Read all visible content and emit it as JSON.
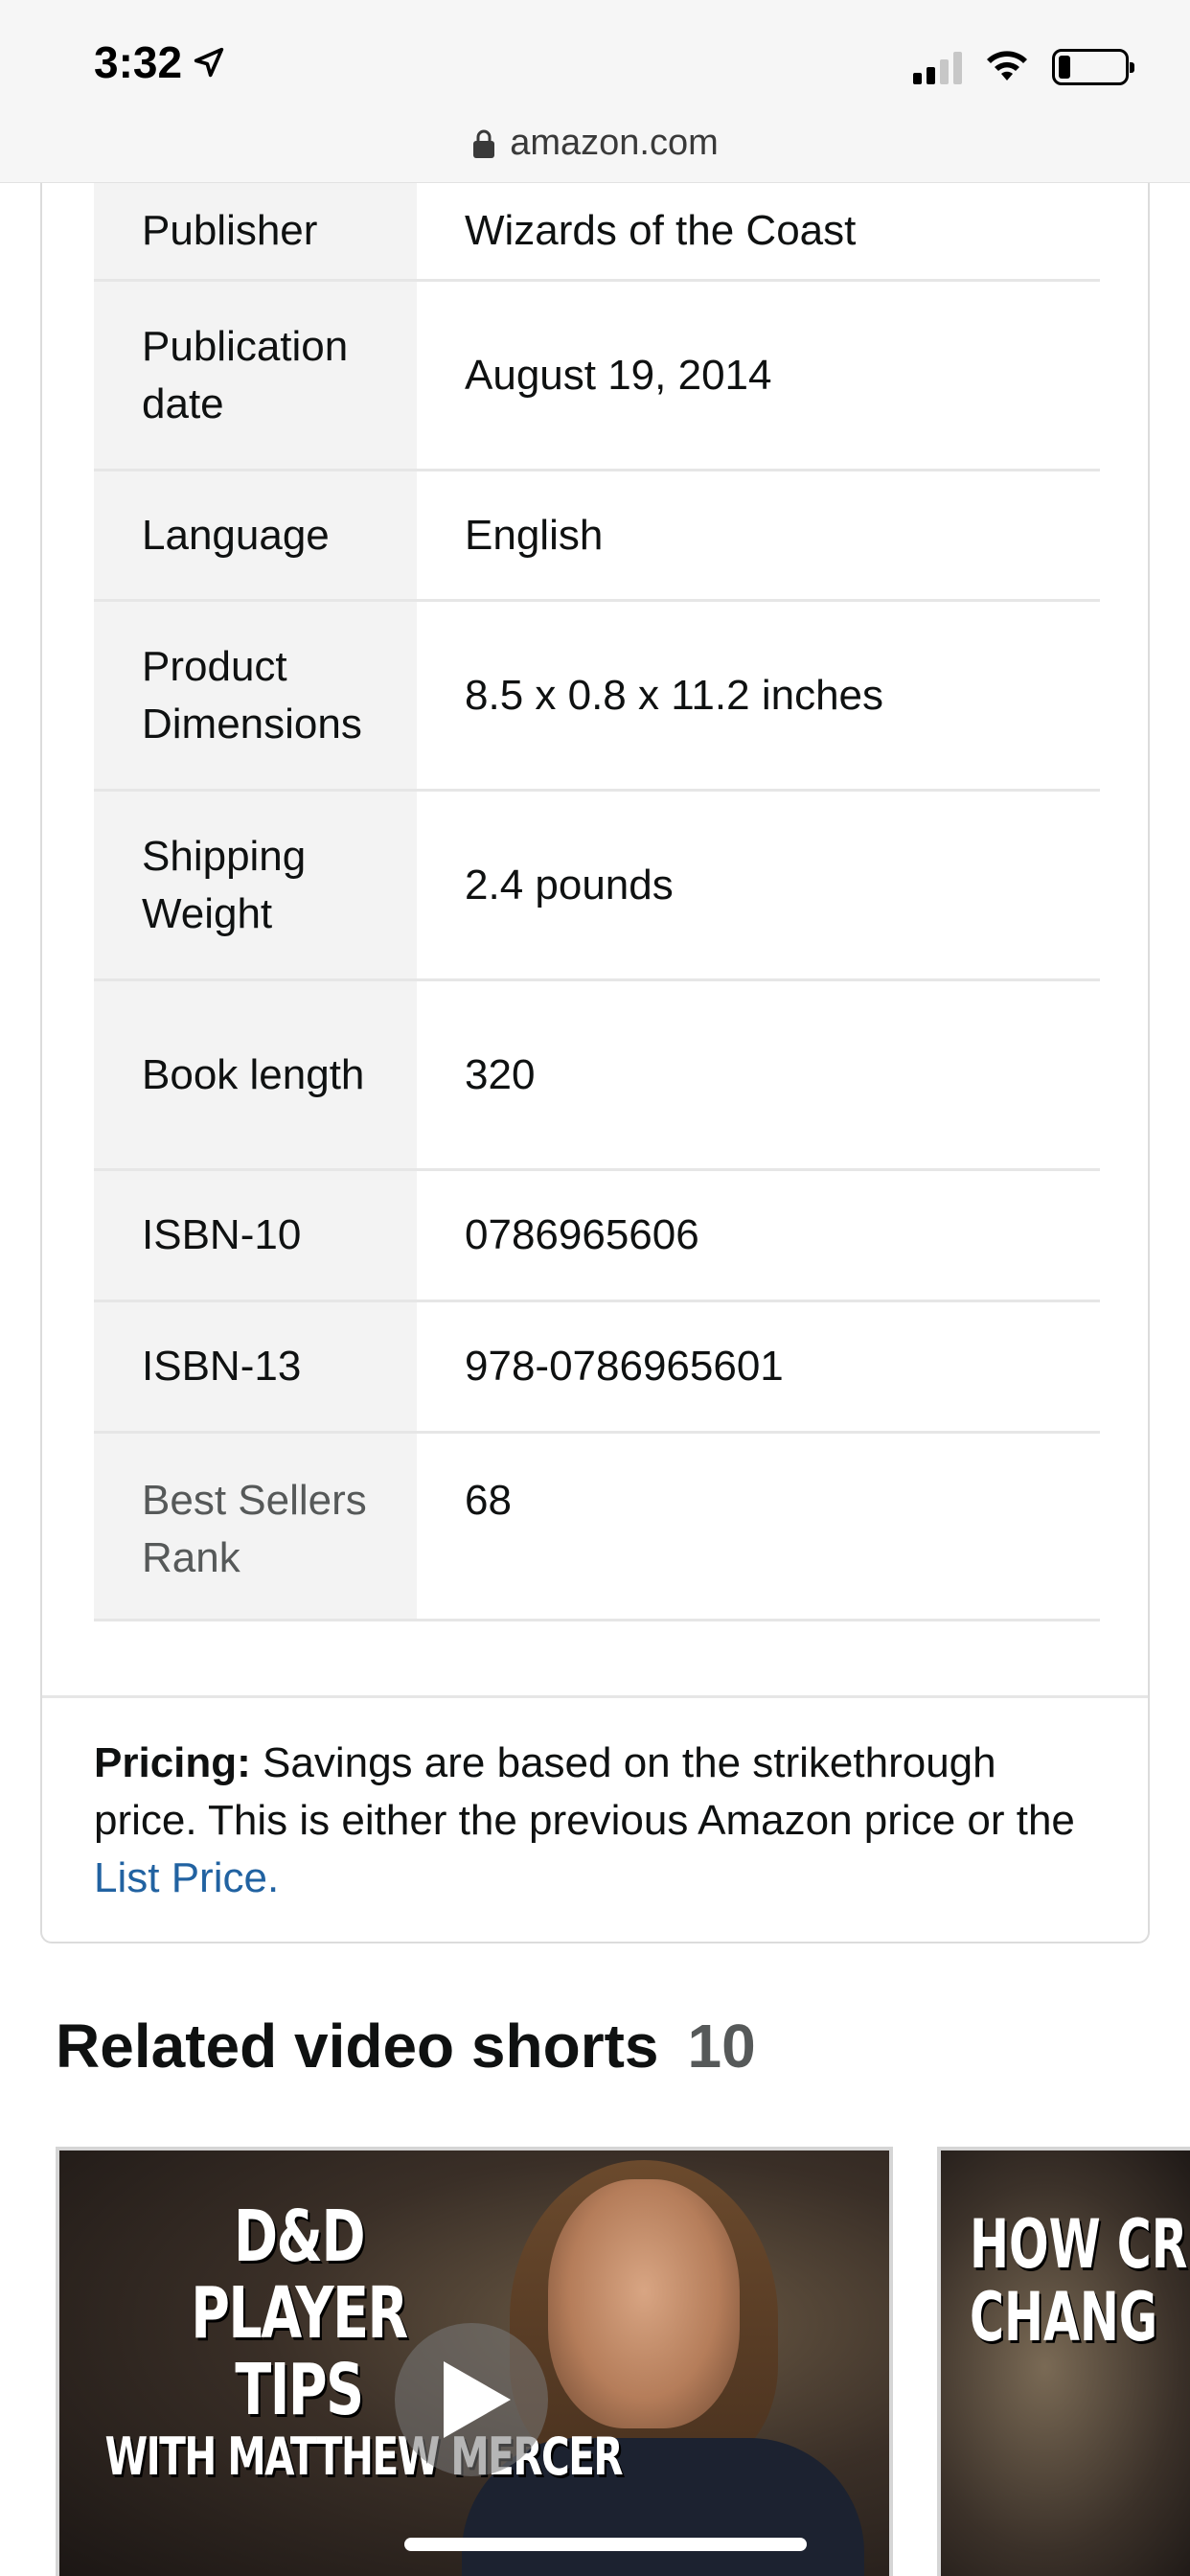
{
  "status_bar": {
    "time": "3:32",
    "location_icon": "location-arrow-icon",
    "signal_icon": "cellular-signal-icon",
    "wifi_icon": "wifi-icon",
    "battery_icon": "battery-low-icon"
  },
  "browser": {
    "url": "amazon.com",
    "lock_icon": "lock-icon"
  },
  "product_details": [
    {
      "label": "Publisher",
      "value": "Wizards of the Coast"
    },
    {
      "label": "Publication date",
      "value": "August 19, 2014"
    },
    {
      "label": "Language",
      "value": "English"
    },
    {
      "label": "Product Dimensions",
      "value": "8.5 x 0.8 x 11.2 inches"
    },
    {
      "label": "Shipping Weight",
      "value": "2.4 pounds"
    },
    {
      "label": "Book length",
      "value": "320"
    },
    {
      "label": "ISBN-10",
      "value": "0786965606"
    },
    {
      "label": "ISBN-13",
      "value": "978-0786965601"
    },
    {
      "label": "Best Sellers Rank",
      "value": "68"
    }
  ],
  "pricing": {
    "label": "Pricing:",
    "text": " Savings are based on the strikethrough price. This is either the previous Amazon price or the ",
    "link": "List Price."
  },
  "related_videos": {
    "title": "Related video shorts",
    "count": "10",
    "videos": [
      {
        "overlay_line1": "D&D PLAYER",
        "overlay_line2": "TIPS",
        "overlay_line3": "WITH MATTHEW MERCER",
        "play_icon": "play-icon"
      },
      {
        "overlay_line1": "HOW CRI",
        "overlay_line2": "CHANG"
      }
    ]
  },
  "colors": {
    "link": "#2162a1",
    "label_background": "#f3f3f3",
    "muted_text": "#565959"
  }
}
